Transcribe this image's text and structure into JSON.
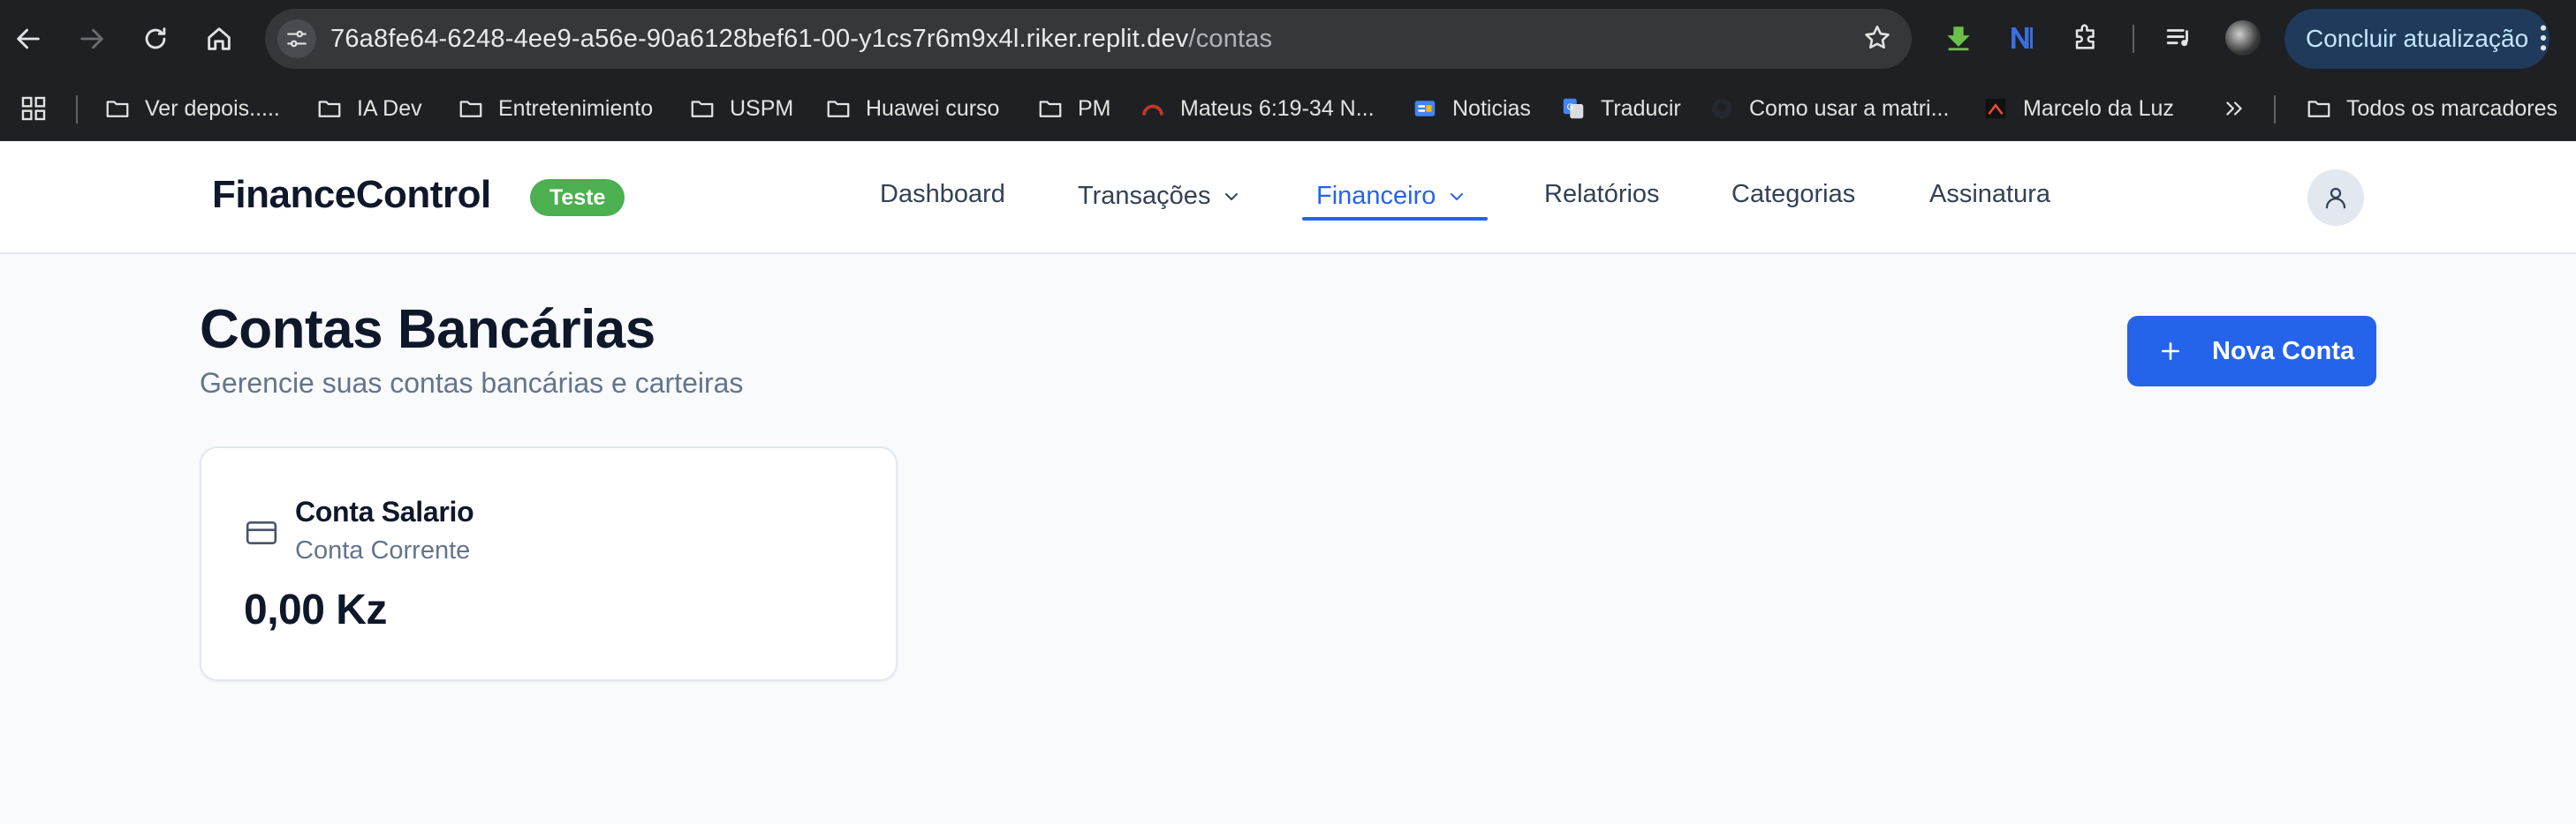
{
  "browser": {
    "url_host": "76a8fe64-6248-4ee9-a56e-90a6128bef61-00-y1cs7r6m9x4l.riker.replit.dev",
    "url_path": "/contas",
    "update_label": "Concluir atualização",
    "bookmarks": [
      {
        "label": "Ver depois.....",
        "icon": "folder-icon"
      },
      {
        "label": "IA Dev",
        "icon": "folder-icon"
      },
      {
        "label": "Entretenimiento",
        "icon": "folder-icon"
      },
      {
        "label": "USPM",
        "icon": "folder-icon"
      },
      {
        "label": "Huawei curso",
        "icon": "folder-icon"
      },
      {
        "label": "PM",
        "icon": "folder-icon"
      },
      {
        "label": "Mateus 6:19-34 N...",
        "icon": "bible-icon"
      },
      {
        "label": "Noticias",
        "icon": "google-news-icon"
      },
      {
        "label": "Traducir",
        "icon": "google-translate-icon"
      },
      {
        "label": "Como usar a matri...",
        "icon": "github-icon"
      },
      {
        "label": "Marcelo da Luz",
        "icon": "site-icon"
      }
    ],
    "all_bookmarks_label": "Todos os marcadores"
  },
  "app": {
    "brand": "FinanceControl",
    "badge": "Teste",
    "nav": {
      "dashboard": "Dashboard",
      "transacoes": "Transações",
      "financeiro": "Financeiro",
      "relatorios": "Relatórios",
      "categorias": "Categorias",
      "assinatura": "Assinatura"
    },
    "active_nav": "Financeiro",
    "accent_color": "#2563eb",
    "badge_color": "#4caf50"
  },
  "page": {
    "title": "Contas Bancárias",
    "subtitle": "Gerencie suas contas bancárias e carteiras",
    "new_button": "Nova Conta"
  },
  "accounts": [
    {
      "name": "Conta Salario",
      "type": "Conta Corrente",
      "balance": "0,00 Kz"
    }
  ]
}
